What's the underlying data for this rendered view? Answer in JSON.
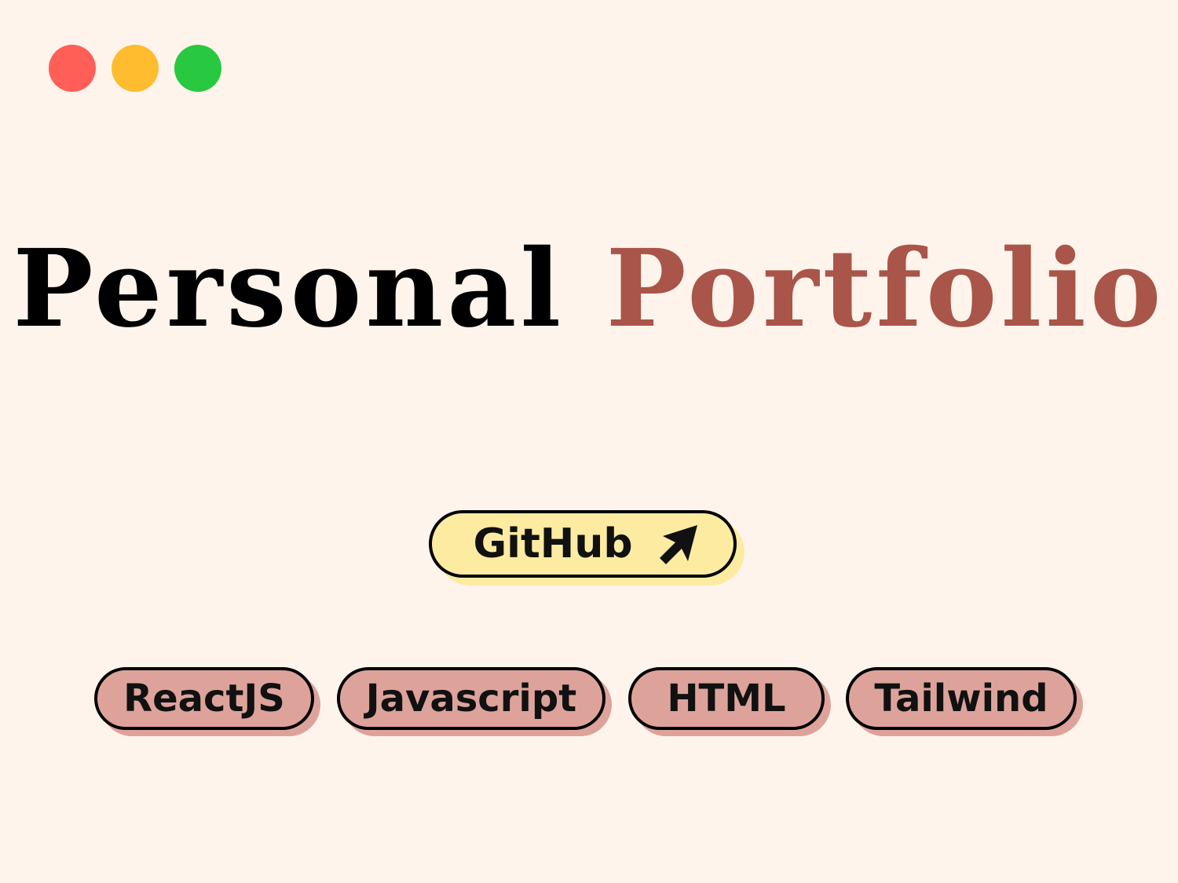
{
  "window_controls": {
    "close_color": "#ff5f57",
    "minimize_color": "#febc2e",
    "maximize_color": "#28c840"
  },
  "hero": {
    "title_part1": "Personal",
    "title_part2": "Portfolio",
    "accent_color": "#a9554a"
  },
  "github_button": {
    "label": "GitHub",
    "icon": "arrow-up-right-icon",
    "bg_color": "#fdeba1"
  },
  "tags": [
    {
      "label": "ReactJS"
    },
    {
      "label": "Javascript"
    },
    {
      "label": "HTML"
    },
    {
      "label": "Tailwind"
    }
  ],
  "tag_bg_color": "#dda39b",
  "page_bg_color": "#fff4ec"
}
